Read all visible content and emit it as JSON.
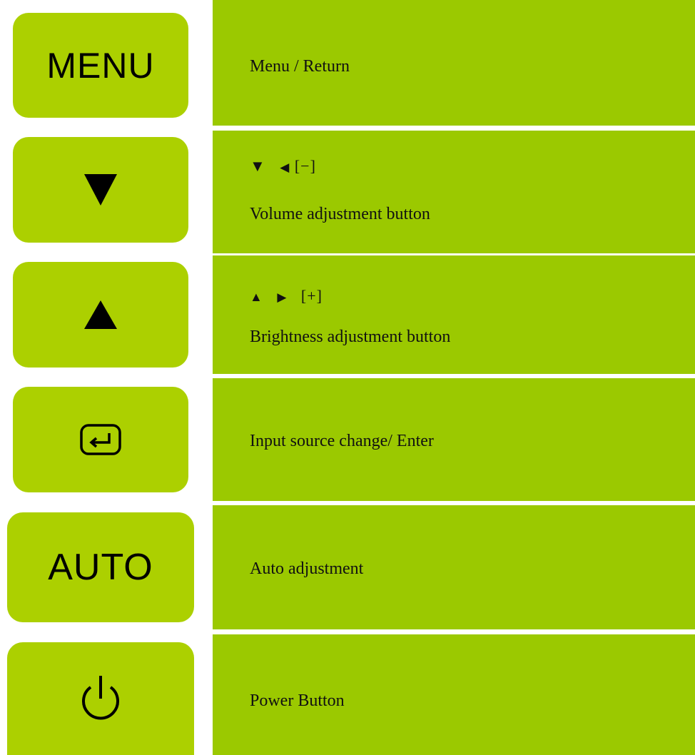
{
  "colors": {
    "button_bg": "#acd000",
    "panel_bg": "#9bc900",
    "text": "#111111"
  },
  "rows": [
    {
      "button": {
        "label": "MENU"
      },
      "description": "Menu / Return"
    },
    {
      "button": {
        "icon": "down-triangle-icon"
      },
      "symbols": {
        "down": "▼",
        "left": "◀",
        "bracket": "[−]"
      },
      "description": "Volume adjustment button"
    },
    {
      "button": {
        "icon": "up-triangle-icon"
      },
      "symbols": {
        "up": "▲",
        "right": "▶",
        "bracket": "[+]"
      },
      "description": "Brightness adjustment button"
    },
    {
      "button": {
        "icon": "enter-icon"
      },
      "description": "Input source change/ Enter"
    },
    {
      "button": {
        "label": "AUTO"
      },
      "description": "Auto adjustment"
    },
    {
      "button": {
        "icon": "power-icon"
      },
      "description": "Power Button"
    }
  ]
}
